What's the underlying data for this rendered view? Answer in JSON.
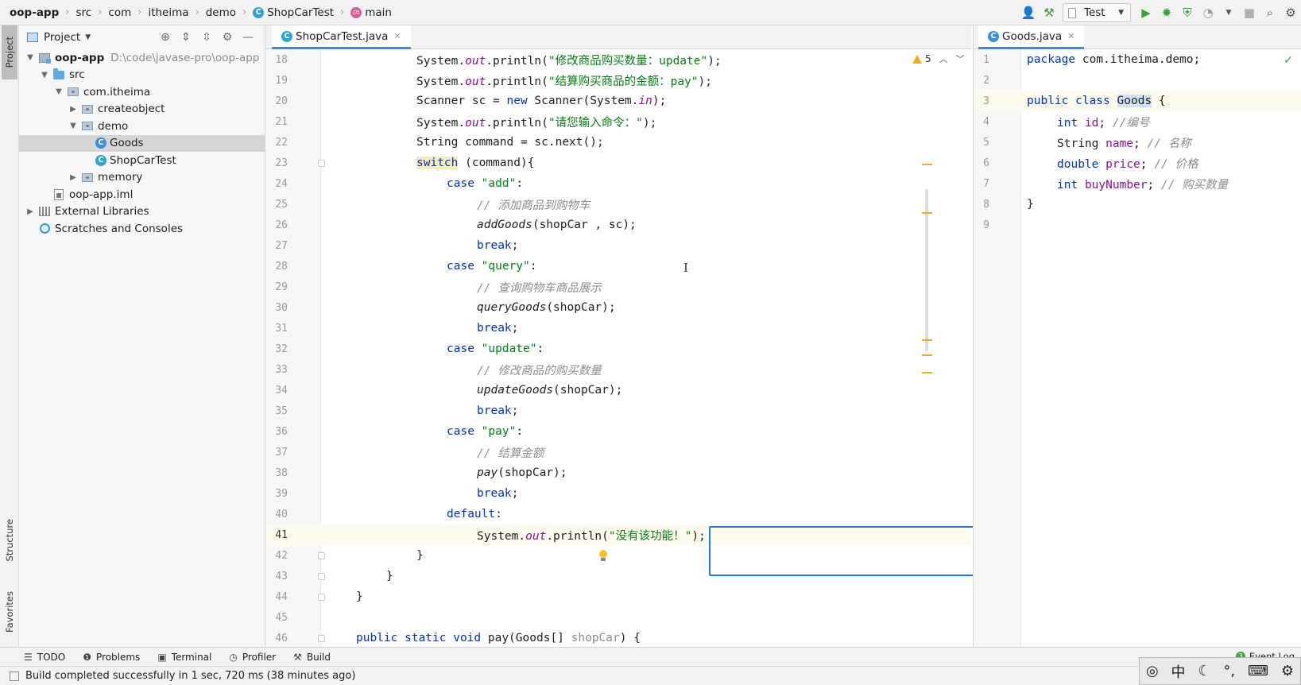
{
  "breadcrumb": {
    "items": [
      "oop-app",
      "src",
      "com",
      "itheima",
      "demo",
      "ShopCarTest",
      "main"
    ]
  },
  "run_config": {
    "label": "Test"
  },
  "left_stripe": {
    "project": "Project",
    "structure": "Structure",
    "favorites": "Favorites"
  },
  "project_panel": {
    "title": "Project",
    "tree": [
      {
        "label": "oop-app",
        "path": "D:\\code\\javase-pro\\oop-app"
      },
      {
        "label": "src"
      },
      {
        "label": "com.itheima"
      },
      {
        "label": "createobject"
      },
      {
        "label": "demo"
      },
      {
        "label": "Goods"
      },
      {
        "label": "ShopCarTest"
      },
      {
        "label": "memory"
      },
      {
        "label": "oop-app.iml"
      },
      {
        "label": "External Libraries"
      },
      {
        "label": "Scratches and Consoles"
      }
    ]
  },
  "editor_main": {
    "tab": "ShopCarTest.java",
    "warning_count": "5",
    "line_numbers": [
      "18",
      "19",
      "20",
      "21",
      "22",
      "23",
      "24",
      "25",
      "26",
      "27",
      "28",
      "29",
      "30",
      "31",
      "32",
      "33",
      "34",
      "35",
      "36",
      "37",
      "38",
      "39",
      "40",
      "41",
      "42",
      "43",
      "44",
      "45",
      "46"
    ]
  },
  "editor_right": {
    "tab": "Goods.java",
    "line_numbers": [
      "1",
      "2",
      "3",
      "4",
      "5",
      "6",
      "7",
      "8",
      "9"
    ]
  },
  "bottom_tools": {
    "todo": "TODO",
    "problems": "Problems",
    "terminal": "Terminal",
    "profiler": "Profiler",
    "build": "Build",
    "event_log": "Event Log"
  },
  "status": {
    "message": "Build completed successfully in 1 sec, 720 ms (38 minutes ago)"
  },
  "ime": {
    "lang": "中"
  },
  "colors": {
    "keyword": "#0033b3",
    "string": "#067d17",
    "comment": "#8c8c8c",
    "selection_border": "#1f7bd8",
    "tab_underline": "#4a88c7"
  }
}
